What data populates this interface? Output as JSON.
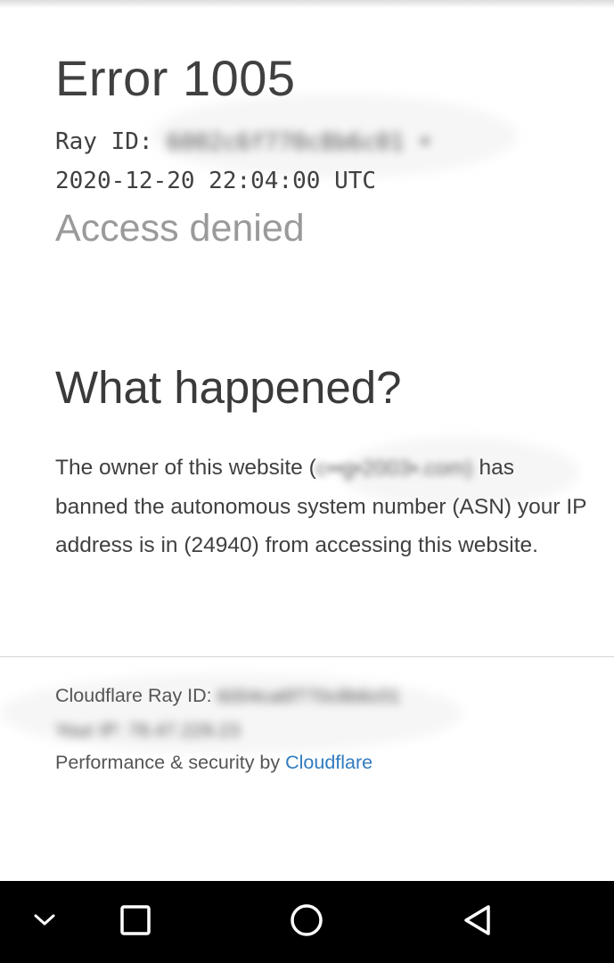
{
  "error": {
    "title": "Error 1005",
    "ray_label": "Ray ID:",
    "ray_value": "6002c6f770c8b6c01 •",
    "timestamp": "2020-12-20 22:04:00 UTC",
    "subtitle": "Access denied"
  },
  "what_happened": {
    "heading": "What happened?",
    "para_start": "The owner of this website (",
    "para_site": "c••g•2003•.com)",
    "para_rest": "has banned the autonomous system number (ASN) your IP address is in (24940) from accessing this website."
  },
  "footer": {
    "ray_label": "Cloudflare Ray ID: ",
    "ray_value": "6004ca6f770c8b6c01",
    "ip_line": "Your IP: 78.47.229.23",
    "perf_text": "Performance & security by ",
    "cloudflare_link": "Cloudflare"
  },
  "navbar": {
    "icons": [
      "chevron-down-icon",
      "square-recents-icon",
      "circle-home-icon",
      "triangle-back-icon"
    ]
  }
}
